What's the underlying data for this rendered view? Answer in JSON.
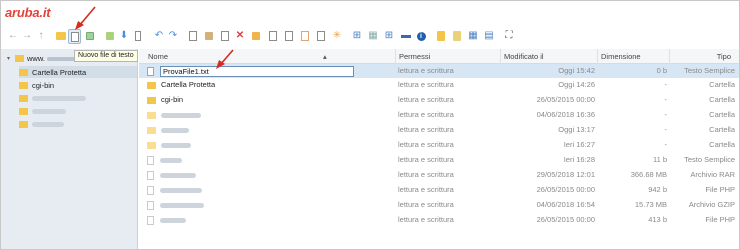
{
  "app": {
    "logo": "aruba.it"
  },
  "toolbar": {
    "tooltip": "Nuovo file di testo",
    "icons": [
      "back-icon",
      "forward-icon",
      "up-icon",
      "new-folder-icon",
      "new-text-file-icon",
      "new-file-icon",
      "upload-icon",
      "download-icon",
      "preview-icon",
      "undo-icon",
      "redo-icon",
      "copy-icon",
      "paste-icon",
      "delete-icon",
      "extract-icon",
      "duplicate-icon",
      "rename-icon",
      "edit-icon",
      "compress-icon",
      "select-all-icon",
      "view-icon",
      "info-icon",
      "icons-view-icon",
      "list-view-icon",
      "fullscreen-icon"
    ]
  },
  "sidebar": {
    "root_label": "www.",
    "items": [
      {
        "label": "Cartella Protetta"
      },
      {
        "label": "cgi-bin"
      },
      {
        "label": ""
      },
      {
        "label": ""
      },
      {
        "label": ""
      }
    ]
  },
  "table": {
    "columns": {
      "name": "Nome",
      "perm": "Permessi",
      "mod": "Modificato il",
      "size": "Dimensione",
      "type": "Tipo"
    },
    "rows": [
      {
        "name": "ProvaFile1.txt",
        "perm": "lettura e scrittura",
        "mod": "Oggi 15:42",
        "size": "0 b",
        "type": "Testo Semplice",
        "kind": "file",
        "editing": true
      },
      {
        "name": "Cartella Protetta",
        "perm": "lettura e scrittura",
        "mod": "Oggi 14:26",
        "size": "-",
        "type": "Cartella",
        "kind": "folder"
      },
      {
        "name": "cgi-bin",
        "perm": "lettura e scrittura",
        "mod": "26/05/2015 00:00",
        "size": "-",
        "type": "Cartella",
        "kind": "folder"
      },
      {
        "name": "",
        "perm": "lettura e scrittura",
        "mod": "04/06/2018 16:36",
        "size": "-",
        "type": "Cartella",
        "kind": "folder"
      },
      {
        "name": "",
        "perm": "lettura e scrittura",
        "mod": "Oggi 13:17",
        "size": "-",
        "type": "Cartella",
        "kind": "folder"
      },
      {
        "name": "",
        "perm": "lettura e scrittura",
        "mod": "Ieri 16:27",
        "size": "-",
        "type": "Cartella",
        "kind": "folder"
      },
      {
        "name": "",
        "perm": "lettura e scrittura",
        "mod": "Ieri 16:28",
        "size": "11 b",
        "type": "Testo Semplice",
        "kind": "file"
      },
      {
        "name": "",
        "perm": "lettura e scrittura",
        "mod": "29/05/2018 12:01",
        "size": "366.68 MB",
        "type": "Archivio RAR",
        "kind": "file"
      },
      {
        "name": "",
        "perm": "lettura e scrittura",
        "mod": "26/05/2015 00:00",
        "size": "942 b",
        "type": "File PHP",
        "kind": "file"
      },
      {
        "name": "",
        "perm": "lettura e scrittura",
        "mod": "04/06/2018 16:54",
        "size": "15.73 MB",
        "type": "Archivio GZIP",
        "kind": "file"
      },
      {
        "name": "",
        "perm": "lettura e scrittura",
        "mod": "26/05/2015 00:00",
        "size": "413 b",
        "type": "File PHP",
        "kind": "file"
      }
    ]
  },
  "colors": {
    "accent": "#e2433a",
    "selection": "#d6e6f5",
    "folder": "#f3c64a",
    "sidebar": "#e7ecf2"
  }
}
